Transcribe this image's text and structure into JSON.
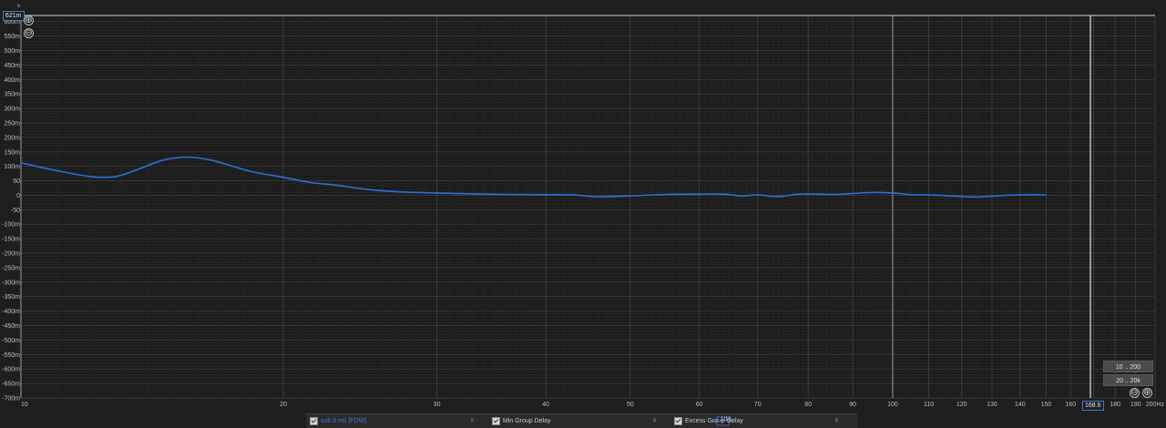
{
  "chart_data": {
    "type": "line",
    "x_scale": "log",
    "xlim": [
      10,
      200
    ],
    "ylim": [
      -0.7,
      0.621
    ],
    "y_unit": "s",
    "x_unit": "Hz",
    "grid": true,
    "x_tick_labels": [
      {
        "v": 10,
        "t": "10"
      },
      {
        "v": 20,
        "t": "20"
      },
      {
        "v": 30,
        "t": "30"
      },
      {
        "v": 40,
        "t": "40"
      },
      {
        "v": 50,
        "t": "50"
      },
      {
        "v": 60,
        "t": "60"
      },
      {
        "v": 70,
        "t": "70"
      },
      {
        "v": 80,
        "t": "80"
      },
      {
        "v": 90,
        "t": "90"
      },
      {
        "v": 100,
        "t": "100"
      },
      {
        "v": 110,
        "t": "110"
      },
      {
        "v": 120,
        "t": "120"
      },
      {
        "v": 130,
        "t": "130"
      },
      {
        "v": 140,
        "t": "140"
      },
      {
        "v": 150,
        "t": "150"
      },
      {
        "v": 160,
        "t": "160"
      },
      {
        "v": 180,
        "t": "180"
      },
      {
        "v": 190,
        "t": "190"
      },
      {
        "v": 200,
        "t": "200Hz"
      }
    ],
    "y_tick_labels": [
      {
        "v": 0.6,
        "t": "600m"
      },
      {
        "v": 0.55,
        "t": "550m"
      },
      {
        "v": 0.5,
        "t": "500m"
      },
      {
        "v": 0.45,
        "t": "450m"
      },
      {
        "v": 0.4,
        "t": "400m"
      },
      {
        "v": 0.35,
        "t": "350m"
      },
      {
        "v": 0.3,
        "t": "300m"
      },
      {
        "v": 0.25,
        "t": "250m"
      },
      {
        "v": 0.2,
        "t": "200m"
      },
      {
        "v": 0.15,
        "t": "150m"
      },
      {
        "v": 0.1,
        "t": "100m"
      },
      {
        "v": 0.05,
        "t": "50"
      },
      {
        "v": 0,
        "t": "0"
      },
      {
        "v": -0.05,
        "t": "-50"
      },
      {
        "v": -0.1,
        "t": "-100m"
      },
      {
        "v": -0.15,
        "t": "-150m"
      },
      {
        "v": -0.2,
        "t": "-200m"
      },
      {
        "v": -0.25,
        "t": "-250m"
      },
      {
        "v": -0.3,
        "t": "-300m"
      },
      {
        "v": -0.35,
        "t": "-350m"
      },
      {
        "v": -0.4,
        "t": "-400m"
      },
      {
        "v": -0.45,
        "t": "-450m"
      },
      {
        "v": -0.5,
        "t": "-500m"
      },
      {
        "v": -0.55,
        "t": "-550m"
      },
      {
        "v": -0.6,
        "t": "-600m"
      },
      {
        "v": -0.65,
        "t": "-650m"
      },
      {
        "v": -0.7,
        "t": "-700m"
      }
    ],
    "cursor_x": 168.6,
    "series": [
      {
        "name": "sub 8 ms [FDW]",
        "color": "#2f6fd6",
        "x": [
          10,
          11,
          12,
          12.8,
          13.5,
          14.5,
          15.5,
          16.5,
          17.5,
          18.5,
          20,
          21.5,
          23,
          25,
          27,
          30,
          33,
          36,
          40,
          43,
          46,
          50,
          55,
          60,
          64,
          67,
          70,
          73,
          75,
          78,
          82,
          86,
          90,
          95,
          100,
          105,
          110,
          115,
          120,
          125,
          130,
          135,
          140,
          145,
          150
        ],
        "y": [
          0.112,
          0.085,
          0.065,
          0.064,
          0.085,
          0.12,
          0.132,
          0.122,
          0.1,
          0.08,
          0.062,
          0.044,
          0.035,
          0.02,
          0.012,
          0.008,
          0.005,
          0.003,
          0.002,
          0.001,
          -0.005,
          -0.002,
          0.003,
          0.004,
          0.004,
          -0.002,
          0.001,
          -0.004,
          -0.003,
          0.004,
          0.004,
          0.003,
          0.006,
          0.01,
          0.008,
          0.002,
          0.001,
          -0.001,
          -0.004,
          -0.006,
          -0.003,
          0.0,
          0.001,
          0.002,
          0.001
        ]
      }
    ]
  },
  "controls": {
    "y_readout": "621m",
    "x_readout": "168.6",
    "unit_top": "s",
    "zoom_in_glyph": "⊕",
    "zoom_out_glyph": "⊖",
    "range_buttons": [
      "10 .. 200",
      "20 .. 20k"
    ]
  },
  "legend": {
    "items": [
      {
        "label": "sub 8 ms [FDW]",
        "color": "#2f6fd6",
        "unit": "s",
        "checked": true
      },
      {
        "label": "Min Group Delay",
        "color": "#c8c8c8",
        "unit": "s",
        "checked": true
      },
      {
        "label": "Excess Group Delay",
        "color": "#c8c8c8",
        "unit": "s",
        "checked": true
      }
    ],
    "smoothing_label": "1/12"
  }
}
